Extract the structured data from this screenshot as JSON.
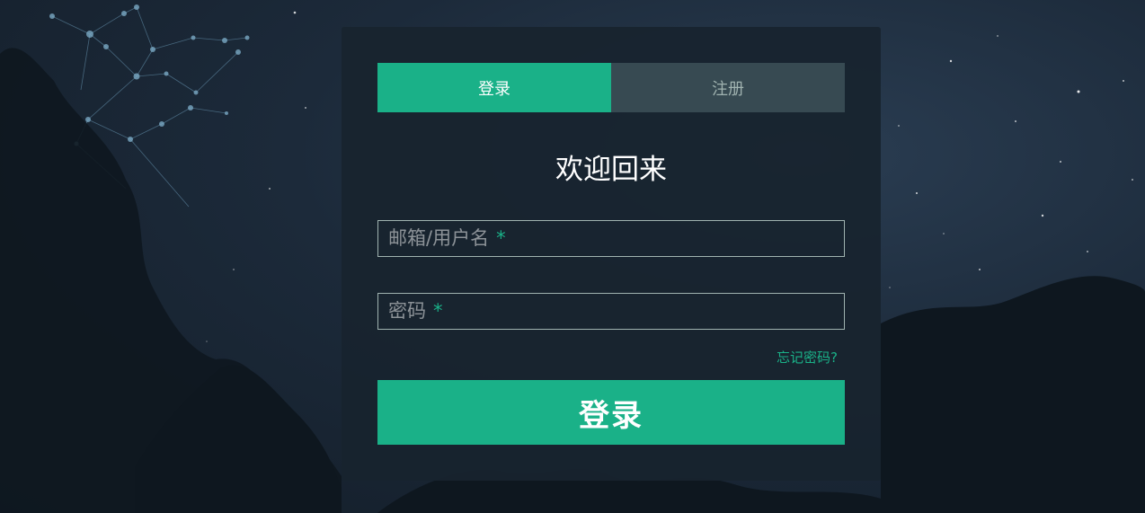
{
  "colors": {
    "accent": "#1ab188",
    "tab_inactive_bg": "#374a52",
    "panel_bg": "#18242e",
    "background": "#1c2a3a"
  },
  "tabs": [
    {
      "label": "登录",
      "active": true
    },
    {
      "label": "注册",
      "active": false
    }
  ],
  "form": {
    "heading": "欢迎回来",
    "username": {
      "placeholder": "邮箱/用户名",
      "required_mark": "*",
      "value": ""
    },
    "password": {
      "placeholder": "密码",
      "required_mark": "*",
      "value": ""
    },
    "forgot_link": "忘记密码?",
    "submit_label": "登录"
  }
}
